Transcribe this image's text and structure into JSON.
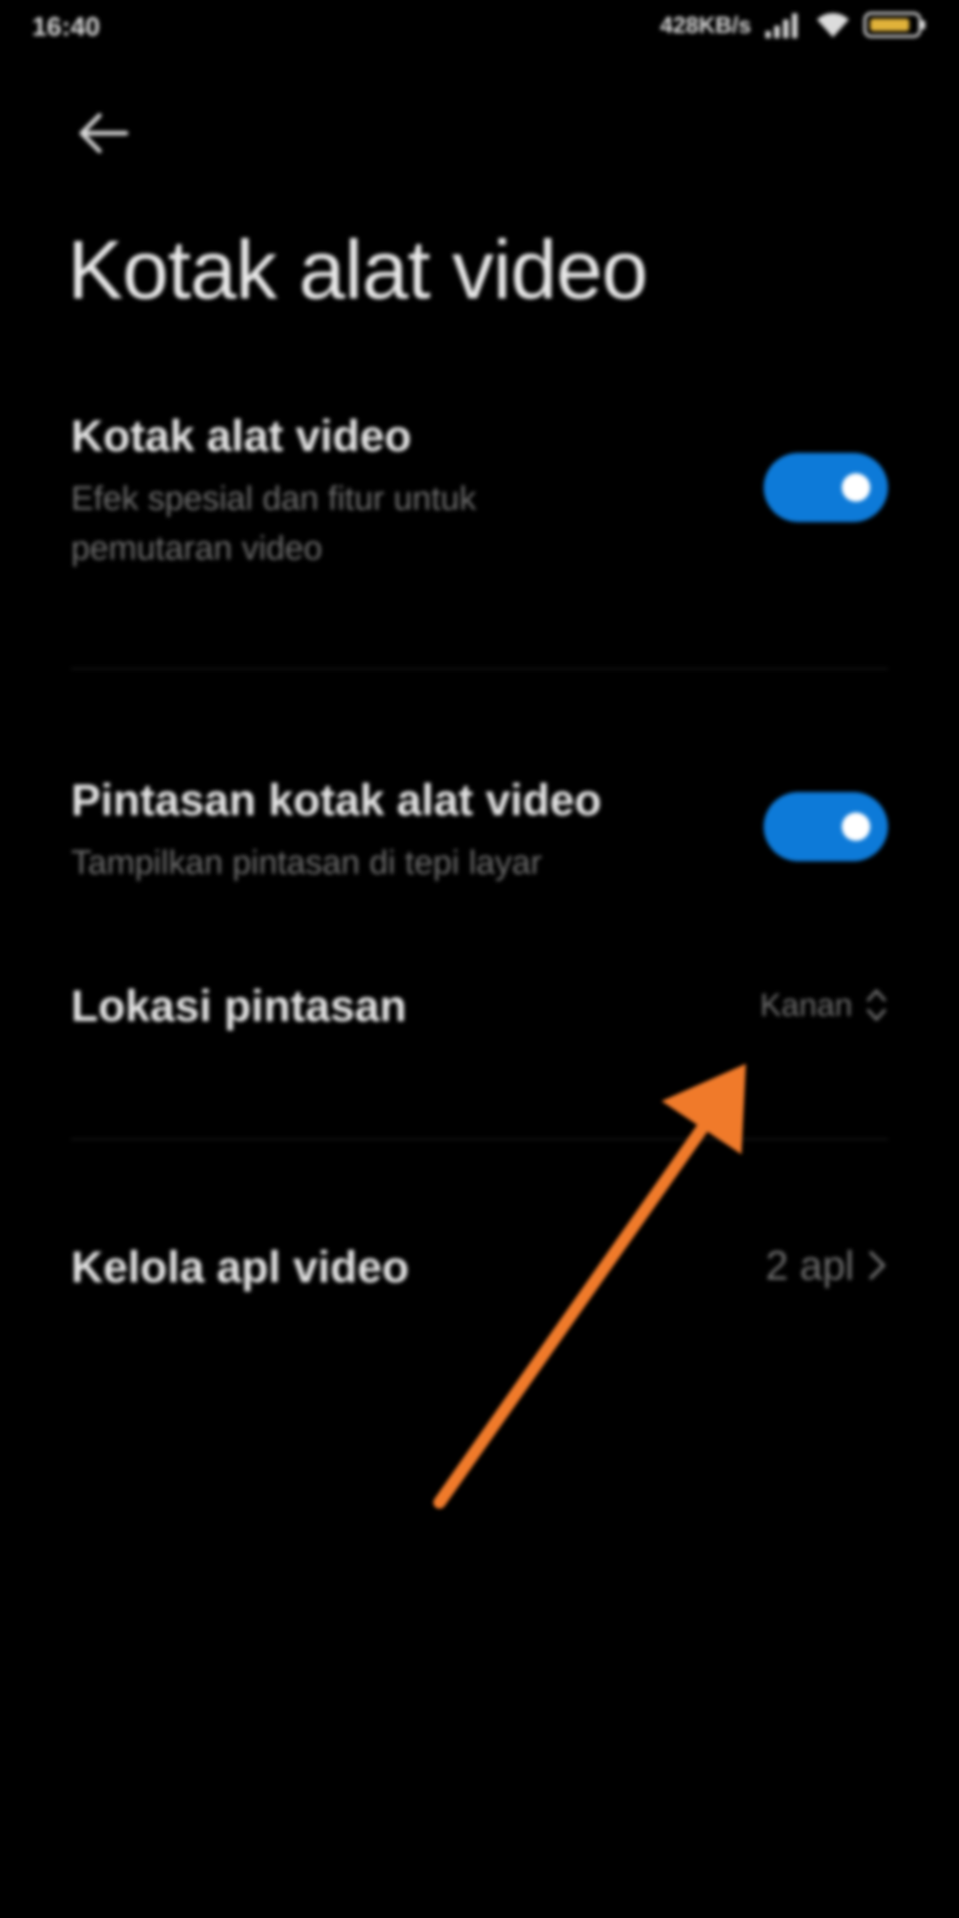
{
  "status_bar": {
    "time": "16:40",
    "network_speed": "428KB/s",
    "icons": [
      "signal-icon",
      "wifi-icon",
      "battery-icon"
    ]
  },
  "header": {
    "back_icon": "arrow-left-icon",
    "title": "Kotak alat video"
  },
  "settings": {
    "video_toolbox": {
      "title": "Kotak alat video",
      "description": "Efek spesial dan fitur untuk pemutaran video",
      "enabled": true
    },
    "shortcut": {
      "title": "Pintasan kotak alat video",
      "description": "Tampilkan pintasan di tepi layar",
      "enabled": true
    },
    "shortcut_location": {
      "title": "Lokasi pintasan",
      "value": "Kanan"
    },
    "manage_apps": {
      "title": "Kelola apl video",
      "value": "2 apl"
    }
  },
  "colors": {
    "background": "#000000",
    "toggle_on": "#0d7ad8",
    "annotation_arrow": "#f07a2a"
  }
}
